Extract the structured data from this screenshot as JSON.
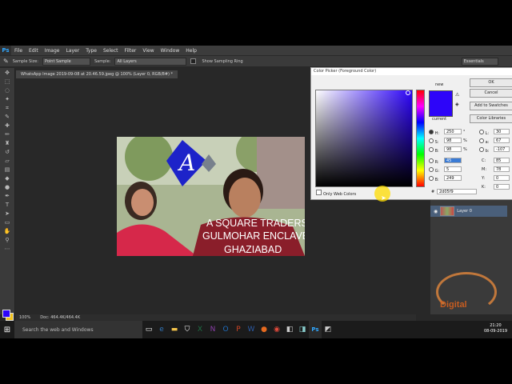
{
  "menu": {
    "logo": "Ps",
    "items": [
      "File",
      "Edit",
      "Image",
      "Layer",
      "Type",
      "Select",
      "Filter",
      "View",
      "Window",
      "Help"
    ]
  },
  "options": {
    "sample_size_label": "Sample Size:",
    "sample_size_value": "Point Sample",
    "sample_label": "Sample:",
    "sample_value": "All Layers",
    "show_ring": "Show Sampling Ring",
    "workspace": "Essentials"
  },
  "document": {
    "tab": "WhatsApp Image 2019-09-08 at 20.46.59.jpeg @ 100% (Layer 0, RGB/8#) *",
    "zoom": "100%",
    "doc_size": "Doc: 464.4K/464.4K"
  },
  "image": {
    "line1": "A SQUARE TRADERS",
    "line2": "GULMOHAR ENCLAVE",
    "line3": "GHAZIABAD",
    "logo_letter": "A"
  },
  "picker": {
    "title": "Color Picker (Foreground Color)",
    "ok": "OK",
    "cancel": "Cancel",
    "add_swatches": "Add to Swatches",
    "libraries": "Color Libraries",
    "new_label": "new",
    "current_label": "current",
    "web_only": "Only Web Colors",
    "h": "250",
    "s": "98",
    "b": "98",
    "r": "45",
    "g": "5",
    "bb": "249",
    "h_unit": "°",
    "pct": "%",
    "l": "30",
    "a": "67",
    "b2": "-107",
    "c": "85",
    "m": "78",
    "y": "0",
    "k": "0",
    "hex": "2d05f9",
    "hash": "#",
    "color": "#2d05f9"
  },
  "layers": {
    "name": "Layer 0"
  },
  "taskbar": {
    "search": "Search the web and Windows",
    "time": "21:20",
    "date": "08-09-2019"
  },
  "watermark": {
    "text": "Digital"
  },
  "colors": {
    "fg": "#2d05f9",
    "bg": "#f2c21b"
  }
}
